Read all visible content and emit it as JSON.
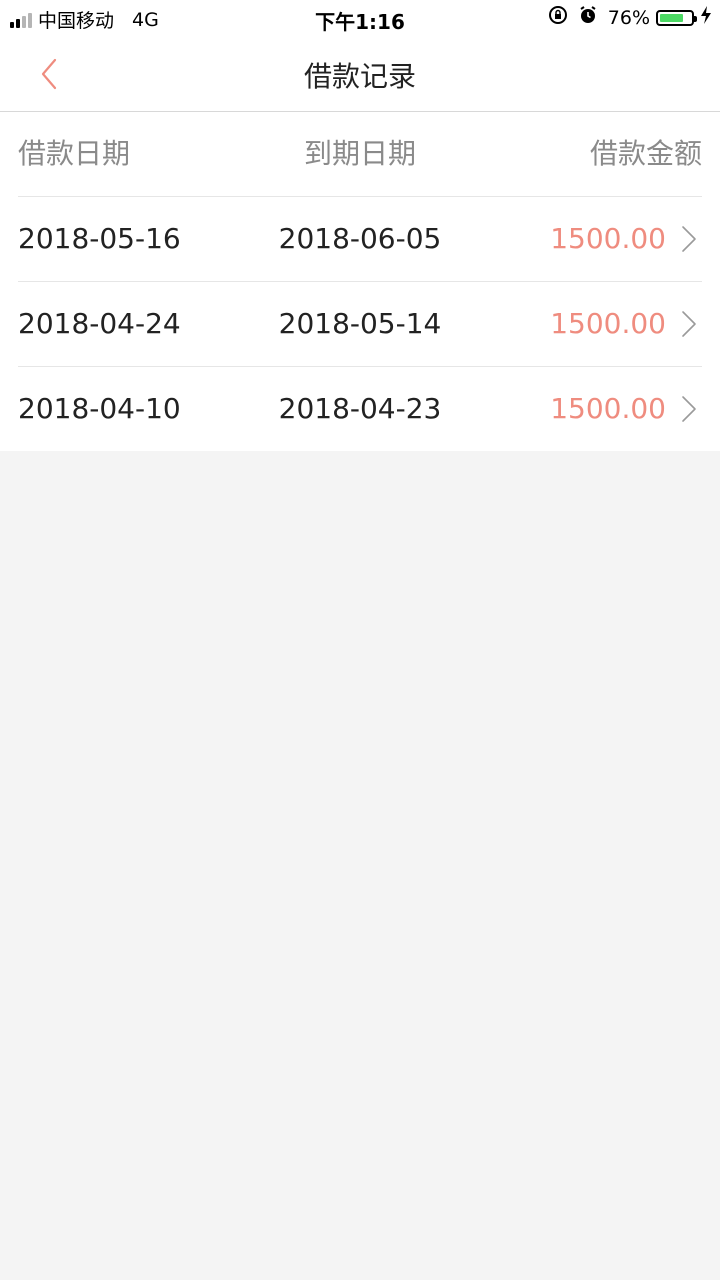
{
  "status_bar": {
    "carrier": "中国移动",
    "network": "4G",
    "time": "下午1:16",
    "battery_percent": "76%",
    "battery_level": 0.76,
    "battery_color": "#4cd964"
  },
  "nav": {
    "back_icon": "chevron-left-icon",
    "title": "借款记录"
  },
  "table": {
    "headers": {
      "borrow_date": "借款日期",
      "due_date": "到期日期",
      "amount": "借款金额"
    },
    "rows": [
      {
        "borrow_date": "2018-05-16",
        "due_date": "2018-06-05",
        "amount": "1500.00"
      },
      {
        "borrow_date": "2018-04-24",
        "due_date": "2018-05-14",
        "amount": "1500.00"
      },
      {
        "borrow_date": "2018-04-10",
        "due_date": "2018-04-23",
        "amount": "1500.00"
      }
    ]
  },
  "colors": {
    "accent": "#ef8c7f",
    "background": "#f4f4f4"
  }
}
